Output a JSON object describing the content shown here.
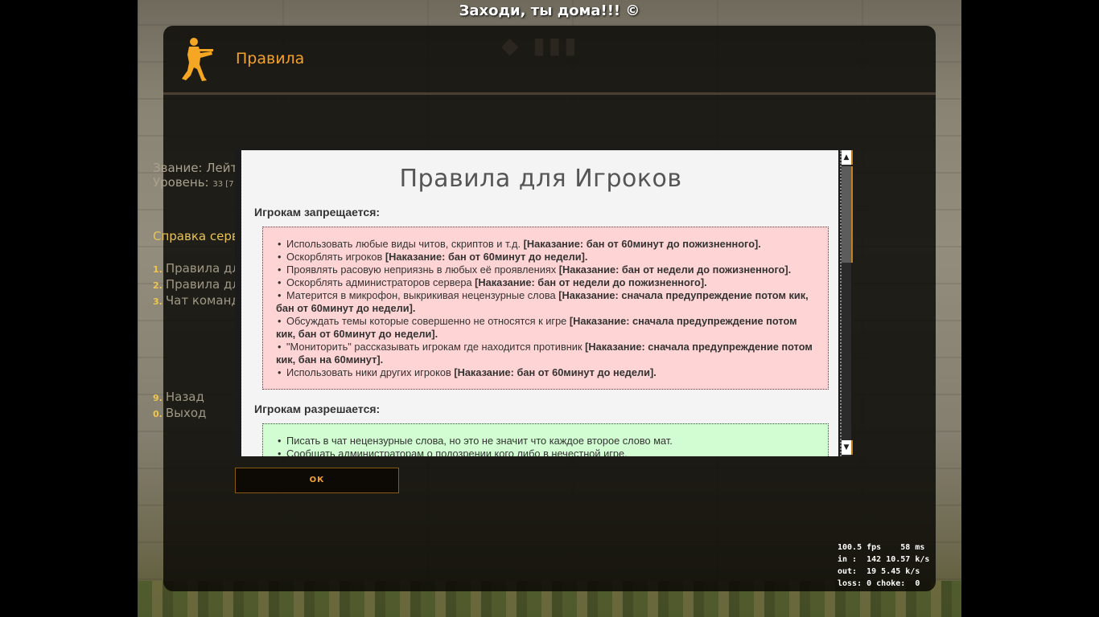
{
  "server_title": "Заходи, ты дома!!! ©",
  "motd": {
    "title": "Правила",
    "logo_icon": "counter-terrorist-soldier-icon"
  },
  "menu": {
    "rank_line": "Звание: Лейт",
    "level_label": "Уровень:",
    "level_value": "33 [7",
    "help_heading": "Справка серв",
    "items": [
      {
        "num": "1.",
        "label": "Правила дл"
      },
      {
        "num": "2.",
        "label": "Правила дл"
      },
      {
        "num": "3.",
        "label": "Чат команд"
      }
    ],
    "back": {
      "num": "9.",
      "label": "Назад"
    },
    "exit": {
      "num": "0.",
      "label": "Выход"
    }
  },
  "rules": {
    "heading": "Правила для Игроков",
    "forbidden_title": "Игрокам запрещается:",
    "forbidden": [
      {
        "text": "Использовать любые виды читов, скриптов и т.д.",
        "penalty": "[Наказание: бан от 60минут до пожизненного]."
      },
      {
        "text": "Оскорблять игроков",
        "penalty": "[Наказание: бан от 60минут до недели]."
      },
      {
        "text": "Проявлять расовую неприязнь в любых её проявлениях",
        "penalty": "[Наказание: бан от недели до пожизненного]."
      },
      {
        "text": "Оскорблять администраторов сервера",
        "penalty": "[Наказание: бан от недели до пожизненного]."
      },
      {
        "text": "Матерится в микрофон, выкрикивая нецензурные слова",
        "penalty": "[Наказание: сначала предупреждение потом кик, бан от 60минут до недели]."
      },
      {
        "text": "Обсуждать темы которые совершенно не относятся к игре",
        "penalty": "[Наказание: сначала предупреждение потом кик, бан от 60минут до недели]."
      },
      {
        "text": "\"Мониторить\" рассказывать игрокам где находится противник",
        "penalty": "[Наказание: сначала предупреждение потом кик, бан на 60минут]."
      },
      {
        "text": "Использовать ники других игроков",
        "penalty": "[Наказание: бан от 60минут до недели]."
      }
    ],
    "allowed_title": "Игрокам разрешается:",
    "allowed": [
      "Писать в чат нецензурные слова, но это не значит что каждое второе слово мат.",
      "Сообщать администраторам о подозрении кого либо в нечестной игре."
    ]
  },
  "ok_label": "ОК",
  "netgraph": {
    "line1": "100.5 fps    58 ms",
    "line2": "in :  142 10.57 k/s",
    "line3": "out:  19 5.45 k/s",
    "line4": "loss: 0 choke:  0"
  },
  "colors": {
    "accent": "#f5a22a",
    "forbidden_bg": "#ffd4d4",
    "allowed_bg": "#d2fdd2"
  }
}
